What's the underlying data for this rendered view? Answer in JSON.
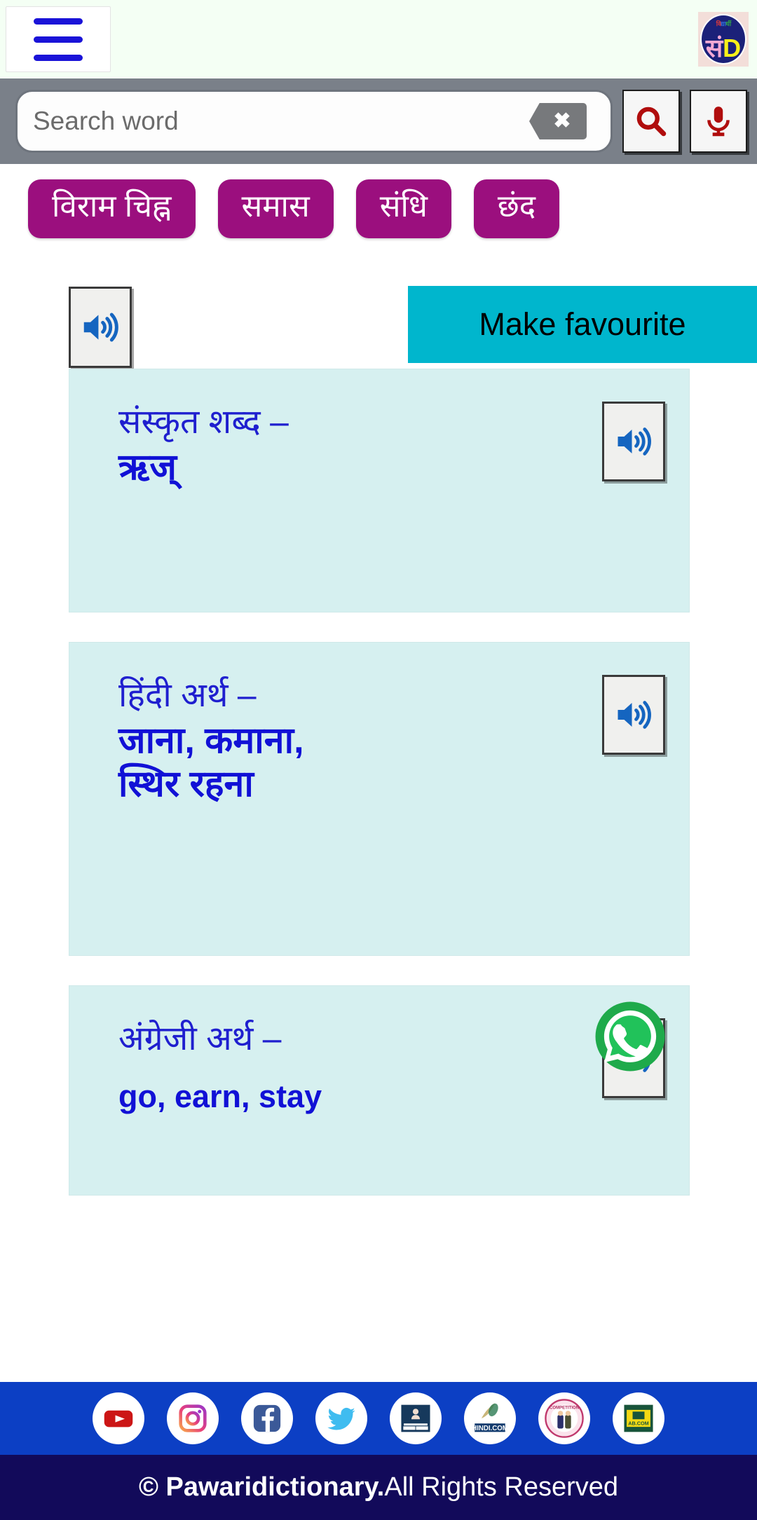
{
  "header": {
    "menu_icon": "hamburger-menu-icon",
    "logo": {
      "tiny_text_1": "वि",
      "tiny_text_2": "द्या",
      "tiny_text_3": "र्थी",
      "main_hindi": "सं",
      "main_latin": "D"
    }
  },
  "search": {
    "placeholder": "Search word",
    "value": "",
    "clear_icon": "backspace-clear-icon",
    "search_icon": "search-icon",
    "mic_icon": "microphone-icon"
  },
  "chips": [
    {
      "label": "विराम चिह्न"
    },
    {
      "label": "समास"
    },
    {
      "label": "संधि"
    },
    {
      "label": "छंद"
    }
  ],
  "actions": {
    "speaker_icon": "speaker-icon",
    "favourite_label": "Make favourite"
  },
  "cards": [
    {
      "label": "संस्कृत शब्द –",
      "value": "ऋज्",
      "action_icon": "speaker-icon"
    },
    {
      "label": "हिंदी अर्थ –",
      "value": "जाना, कमाना,\nस्थिर रहना",
      "action_icon": "speaker-icon"
    },
    {
      "label": "अंग्रेजी अर्थ –",
      "value": "go, earn, stay",
      "action_icon": "whatsapp-share-icon"
    }
  ],
  "footer": {
    "social": [
      {
        "name": "youtube-icon"
      },
      {
        "name": "instagram-icon"
      },
      {
        "name": "facebook-icon"
      },
      {
        "name": "twitter-icon"
      },
      {
        "name": "vidyarthi-logo-icon"
      },
      {
        "name": "hindi-com-logo-icon"
      },
      {
        "name": "competition-logo-icon"
      },
      {
        "name": "book-logo-icon"
      }
    ],
    "copyright_brand": "© Pawaridictionary.",
    "copyright_rest": " All Rights Reserved"
  },
  "colors": {
    "header_bg": "#f4fff4",
    "search_bar_bg": "#7a8089",
    "chip_bg": "#9b0f7e",
    "card_bg": "#d6f0f0",
    "favourite_bg": "#00b6cd",
    "social_bar_bg": "#0c3fc4",
    "copyright_bg": "#120a5a",
    "text_blue": "#1f1fcf",
    "icon_red": "#b00d0d"
  }
}
